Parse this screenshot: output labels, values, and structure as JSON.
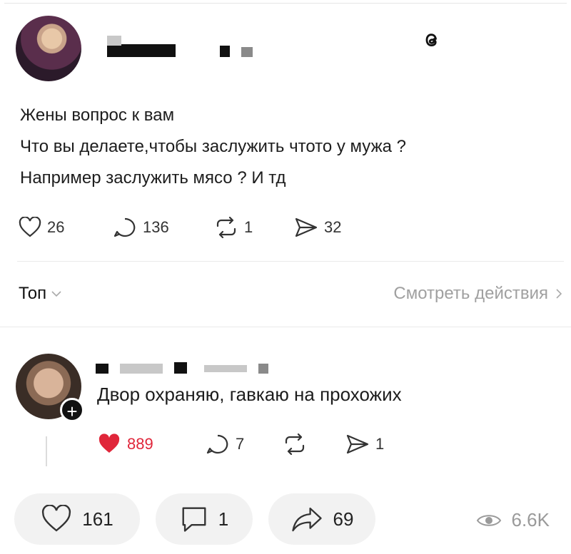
{
  "post": {
    "lines": [
      "Жены вопрос к вам",
      "Что вы делаете,чтобы заслужить чтото у мужа ?",
      "Например заслужить мясо ? И тд"
    ],
    "likes": "26",
    "replies": "136",
    "reposts": "1",
    "shares": "32"
  },
  "sort": {
    "label": "Топ",
    "activity_link": "Смотреть действия"
  },
  "comment": {
    "text": "Двор охраняю, гавкаю на прохожих",
    "likes": "889",
    "replies": "7",
    "shares": "1"
  },
  "bottom_bar": {
    "likes": "161",
    "comments": "1",
    "shares": "69",
    "views": "6.6K"
  },
  "colors": {
    "liked": "#e0263a",
    "muted": "#a0a0a0"
  },
  "icons": {
    "threads": "threads-logo-icon",
    "heart": "heart-icon",
    "reply": "reply-bubble-icon",
    "repost": "repost-icon",
    "send": "send-icon",
    "eye": "eye-icon"
  }
}
